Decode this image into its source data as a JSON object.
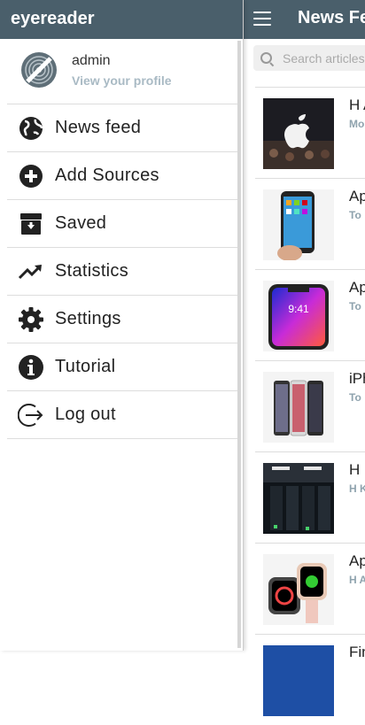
{
  "app_bar": {
    "title": "News Fe"
  },
  "search": {
    "placeholder": "Search articles"
  },
  "feed": {
    "articles": [
      {
        "title": "H A",
        "source": "Mo"
      },
      {
        "title": "Ap",
        "source": "To"
      },
      {
        "title": "Ap",
        "source": "To"
      },
      {
        "title": "iPh",
        "source": "To"
      },
      {
        "title": "H I",
        "source": "H K"
      },
      {
        "title": "Ap",
        "source": "H A"
      },
      {
        "title": "Fin",
        "source": ""
      }
    ]
  },
  "drawer": {
    "brand": "eyereader",
    "profile": {
      "name": "admin",
      "link": "View your profile"
    },
    "menu": [
      {
        "label": "News feed",
        "icon": "globe-icon"
      },
      {
        "label": "Add Sources",
        "icon": "plus-circle-icon"
      },
      {
        "label": "Saved",
        "icon": "archive-icon"
      },
      {
        "label": "Statistics",
        "icon": "trending-up-icon"
      },
      {
        "label": "Settings",
        "icon": "gear-icon"
      },
      {
        "label": "Tutorial",
        "icon": "info-icon"
      },
      {
        "label": "Log out",
        "icon": "logout-icon"
      }
    ]
  },
  "colors": {
    "header": "#4a5f6b",
    "link": "#a9bac4",
    "source": "#8fa3ae"
  }
}
